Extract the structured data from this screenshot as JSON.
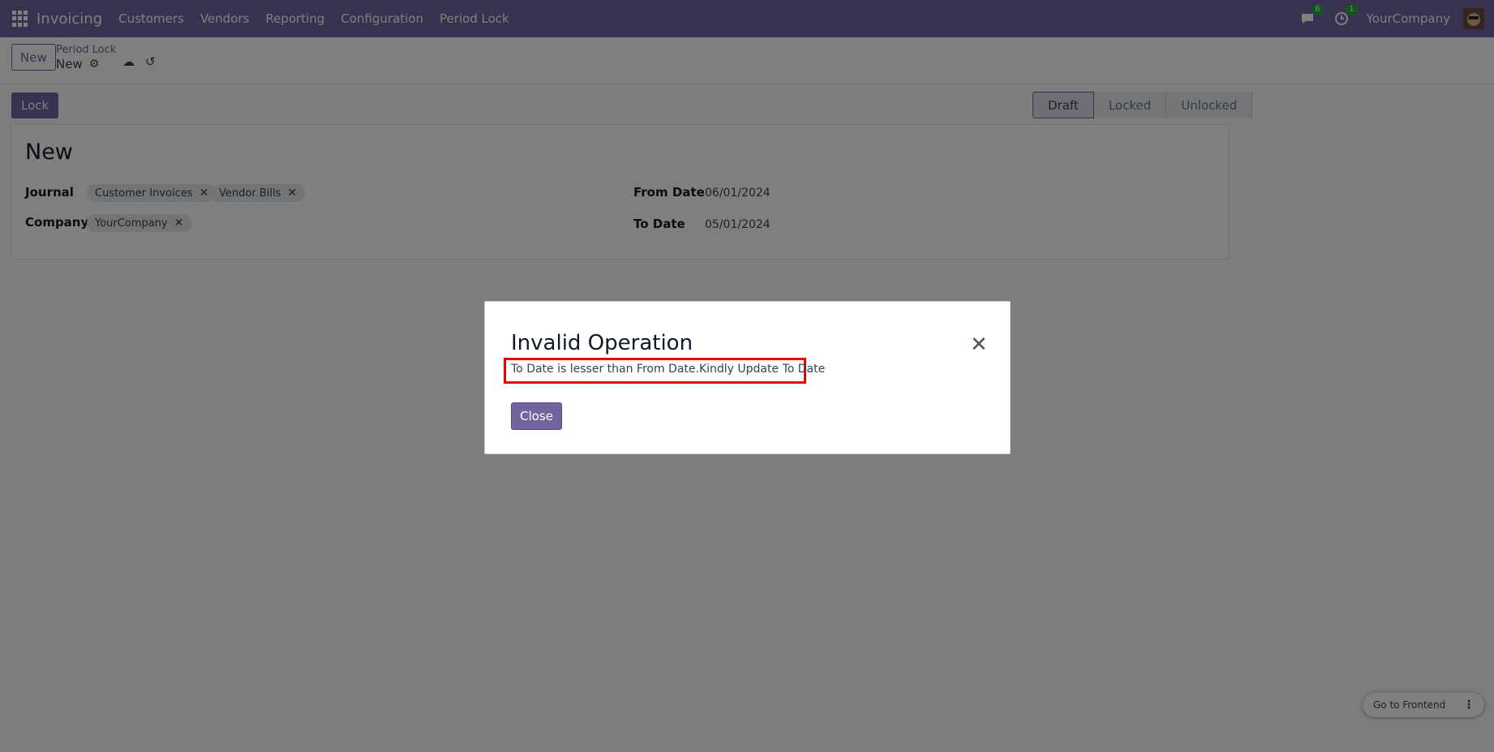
{
  "navbar": {
    "app_name": "Invoicing",
    "menu": [
      "Customers",
      "Vendors",
      "Reporting",
      "Configuration",
      "Period Lock"
    ],
    "messages_badge": "6",
    "activities_badge": "1",
    "company": "YourCompany"
  },
  "control_panel": {
    "new_label": "New",
    "breadcrumb": "Period Lock",
    "record_name": "New",
    "icons": [
      "gear-icon",
      "save-cloud-icon",
      "discard-icon"
    ]
  },
  "form": {
    "lock_label": "Lock",
    "stages": [
      "Draft",
      "Locked",
      "Unlocked"
    ],
    "active_stage": "Draft",
    "title": "New",
    "journal_label": "Journal",
    "journal_tags": [
      "Customer Invoices",
      "Vendor Bills"
    ],
    "company_label": "Company",
    "company_tags": [
      "YourCompany"
    ],
    "from_date_label": "From Date",
    "from_date": "06/01/2024",
    "to_date_label": "To Date",
    "to_date": "05/01/2024"
  },
  "dialog": {
    "title": "Invalid Operation",
    "message": "To Date is lesser than From Date.Kindly Update To Date",
    "close_label": "Close"
  },
  "frontend": {
    "label": "Go to Frontend"
  },
  "colors": {
    "brand": "#71639e",
    "highlight": "#e00000",
    "badge": "#28a745"
  }
}
